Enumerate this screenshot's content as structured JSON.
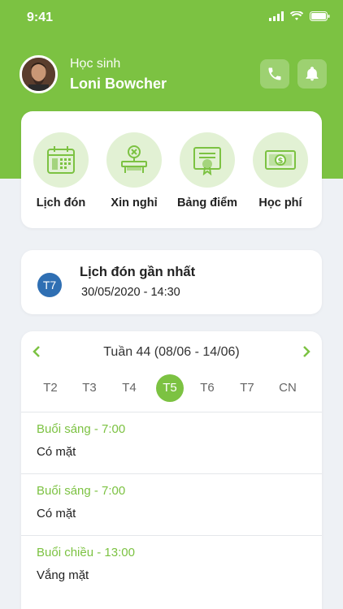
{
  "status": {
    "time": "9:41"
  },
  "profile": {
    "role": "Học sinh",
    "name": "Loni Bowcher"
  },
  "menu": [
    {
      "label": "Lịch đón",
      "icon": "calendar-icon"
    },
    {
      "label": "Xin nghỉ",
      "icon": "leave-desk-icon"
    },
    {
      "label": "Bảng điểm",
      "icon": "certificate-icon"
    },
    {
      "label": "Học phí",
      "icon": "money-icon"
    }
  ],
  "next_pickup": {
    "badge": "T7",
    "title": "Lịch đón gần nhất",
    "datetime": "30/05/2020 - 14:30"
  },
  "week": {
    "title": "Tuần 44 (08/06 - 14/06)",
    "days": [
      "T2",
      "T3",
      "T4",
      "T5",
      "T6",
      "T7",
      "CN"
    ],
    "selected_day": "T5"
  },
  "sessions": [
    {
      "time": "Buổi sáng - 7:00",
      "status": "Có mặt"
    },
    {
      "time": "Buổi sáng - 7:00",
      "status": "Có mặt"
    },
    {
      "time": "Buổi chiều - 13:00",
      "status": "Vắng mặt"
    }
  ],
  "colors": {
    "primary": "#7cc242",
    "badge": "#2f6fb3",
    "background": "#eef1f5"
  }
}
